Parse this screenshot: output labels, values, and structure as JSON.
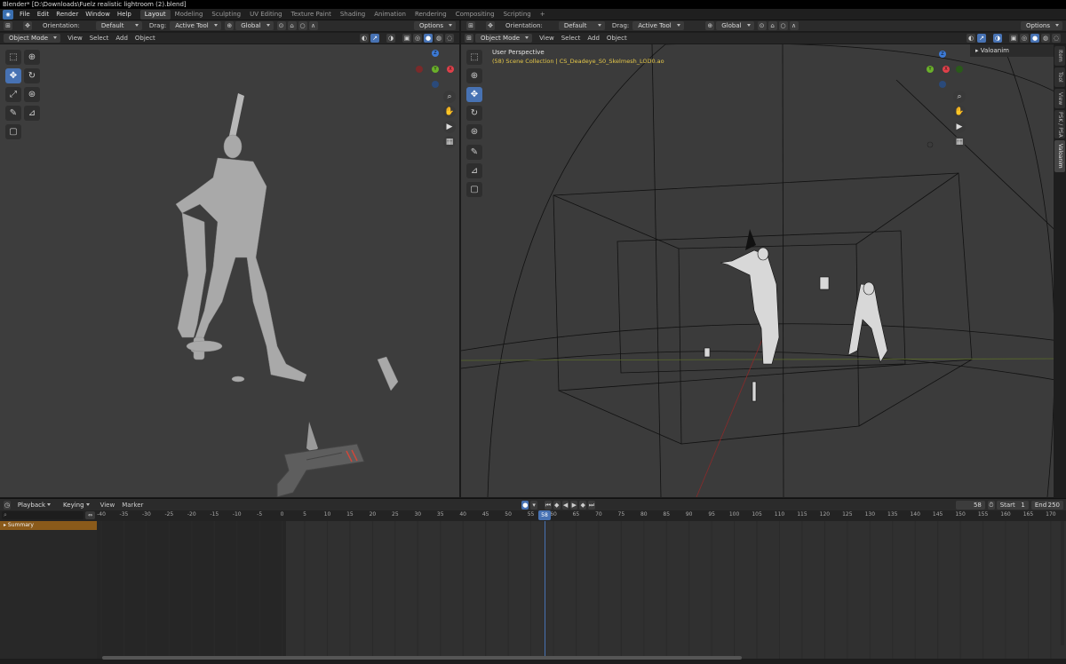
{
  "window": {
    "title": "Blender* [D:\\Downloads\\Fuelz realistic lightroom (2).blend]"
  },
  "topbar": {
    "menus": [
      "File",
      "Edit",
      "Render",
      "Window",
      "Help"
    ],
    "workspaces": [
      "Layout",
      "Modeling",
      "Sculpting",
      "UV Editing",
      "Texture Paint",
      "Shading",
      "Animation",
      "Rendering",
      "Compositing",
      "Scripting"
    ],
    "active_workspace": "Layout",
    "add_workspace": "+"
  },
  "left_viewport": {
    "tool_header": {
      "orientation_label": "Orientation:",
      "orientation_value": "Default",
      "drag_label": "Drag:",
      "drag_value": "Active Tool",
      "transform_space": "Global",
      "options": "Options"
    },
    "header": {
      "mode": "Object Mode",
      "menus": [
        "View",
        "Select",
        "Add",
        "Object"
      ]
    },
    "gizmo": {
      "z": "Z",
      "y": "Y",
      "x": "X"
    }
  },
  "right_viewport": {
    "tool_header": {
      "orientation_label": "Orientation:",
      "orientation_value": "Default",
      "drag_label": "Drag:",
      "drag_value": "Active Tool",
      "transform_space": "Global",
      "options": "Options"
    },
    "header": {
      "mode": "Object Mode",
      "menus": [
        "View",
        "Select",
        "Add",
        "Object"
      ]
    },
    "overlay": {
      "perspective": "User Perspective",
      "collection": "(58) Scene Collection | CS_Deadeye_S0_Skelmesh_LOD0.ao"
    },
    "sidebar": {
      "panel_title": "Valoanim",
      "tabs": [
        "Item",
        "Tool",
        "View",
        "PSK / PSA",
        "Valoanim"
      ],
      "active_tab": "Valoanim"
    },
    "gizmo": {
      "z": "Z",
      "y": "Y",
      "x": "X"
    }
  },
  "timeline": {
    "menus": [
      "Playback",
      "Keying",
      "View",
      "Marker"
    ],
    "current_frame": "58",
    "start_label": "Start",
    "start": "1",
    "end_label": "End",
    "end": "250",
    "ruler_ticks": [
      -40,
      -35,
      -30,
      -25,
      -20,
      -15,
      -10,
      -5,
      0,
      5,
      10,
      15,
      20,
      25,
      30,
      35,
      40,
      45,
      50,
      55,
      60,
      65,
      70,
      75,
      80,
      85,
      90,
      95,
      100,
      105,
      110,
      115,
      120,
      125,
      130,
      135,
      140,
      145,
      150,
      155,
      160,
      165,
      170
    ],
    "summary_label": "Summary"
  },
  "colors": {
    "accent": "#4772b3",
    "x_axis": "#e0404a",
    "y_axis": "#6ab02a",
    "z_axis": "#3c7ad6",
    "summary": "#8a5a1a"
  }
}
